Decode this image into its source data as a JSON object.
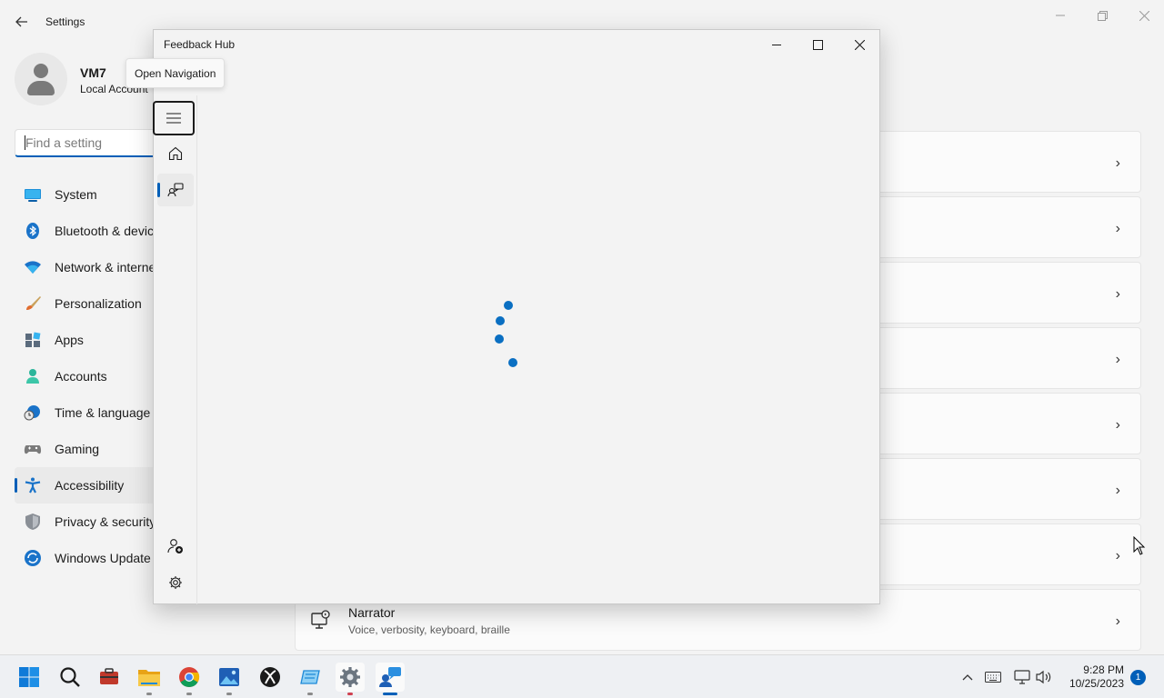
{
  "settings": {
    "title": "Settings",
    "user": {
      "name": "VM7",
      "account_type": "Local Account"
    },
    "search": {
      "placeholder": "Find a setting"
    },
    "nav_items": [
      {
        "label": "System",
        "icon": "system-icon"
      },
      {
        "label": "Bluetooth & devices",
        "icon": "bluetooth-icon"
      },
      {
        "label": "Network & internet",
        "icon": "wifi-icon"
      },
      {
        "label": "Personalization",
        "icon": "brush-icon"
      },
      {
        "label": "Apps",
        "icon": "apps-icon"
      },
      {
        "label": "Accounts",
        "icon": "person-icon"
      },
      {
        "label": "Time & language",
        "icon": "globe-clock-icon"
      },
      {
        "label": "Gaming",
        "icon": "gamepad-icon"
      },
      {
        "label": "Accessibility",
        "icon": "accessibility-icon",
        "active": true
      },
      {
        "label": "Privacy & security",
        "icon": "shield-icon"
      },
      {
        "label": "Windows Update",
        "icon": "update-icon"
      }
    ],
    "narrator": {
      "title": "Narrator",
      "subtitle": "Voice, verbosity, keyboard, braille"
    }
  },
  "feedback_hub": {
    "title": "Feedback Hub",
    "tooltip": "Open Navigation"
  },
  "taskbar": {
    "time": "9:28 PM",
    "date": "10/25/2023",
    "notification_count": "1",
    "apps": [
      "start-icon",
      "search-icon",
      "toolbox-icon",
      "file-explorer-icon",
      "chrome-icon",
      "photos-icon",
      "xbox-icon",
      "app-window-icon",
      "settings-gear-icon",
      "feedback-hub-icon"
    ]
  },
  "colors": {
    "accent": "#005fb8",
    "spinner": "#0a6fc2"
  }
}
